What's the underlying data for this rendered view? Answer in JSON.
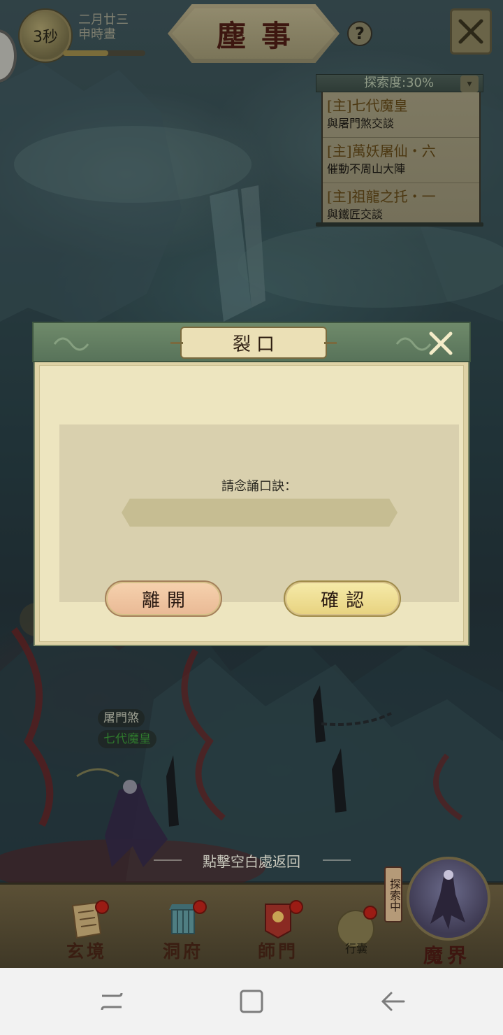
{
  "topbar": {
    "timer": "3秒",
    "date_line1": "二月廿三",
    "date_line2": "申時晝",
    "day_progress": 0.55,
    "title": "塵事",
    "help": "?"
  },
  "quest_panel": {
    "exploration_label": "探索度:30%",
    "quests": [
      {
        "title": "[主]七代魔皇",
        "desc": "與屠門煞交談"
      },
      {
        "title": "[主]萬妖屠仙・六",
        "desc": "催動不周山大陣"
      },
      {
        "title": "[主]祖龍之托・一",
        "desc": "與鐵匠交談"
      }
    ]
  },
  "dialog": {
    "title": "裂口",
    "prompt": "請念誦口訣：",
    "input_value": "",
    "input_placeholder": "",
    "leave_label": "離開",
    "confirm_label": "確認"
  },
  "scene": {
    "npc_name": "屠門煞",
    "boss_name": "七代魔皇",
    "hint": "點擊空白處返回"
  },
  "bottom_nav": {
    "items": [
      {
        "label": "玄境"
      },
      {
        "label": "洞府"
      },
      {
        "label": "師門"
      }
    ],
    "bag_label": "行囊",
    "realm_status": "探索中",
    "realm_label": "魔界"
  },
  "colors": {
    "dialog_header": "#6f8a6a",
    "dialog_bg": "#ede5bf",
    "leave_button": "#f1c8a4",
    "confirm_button": "#f0e096",
    "red_dot": "#9b1c14"
  }
}
